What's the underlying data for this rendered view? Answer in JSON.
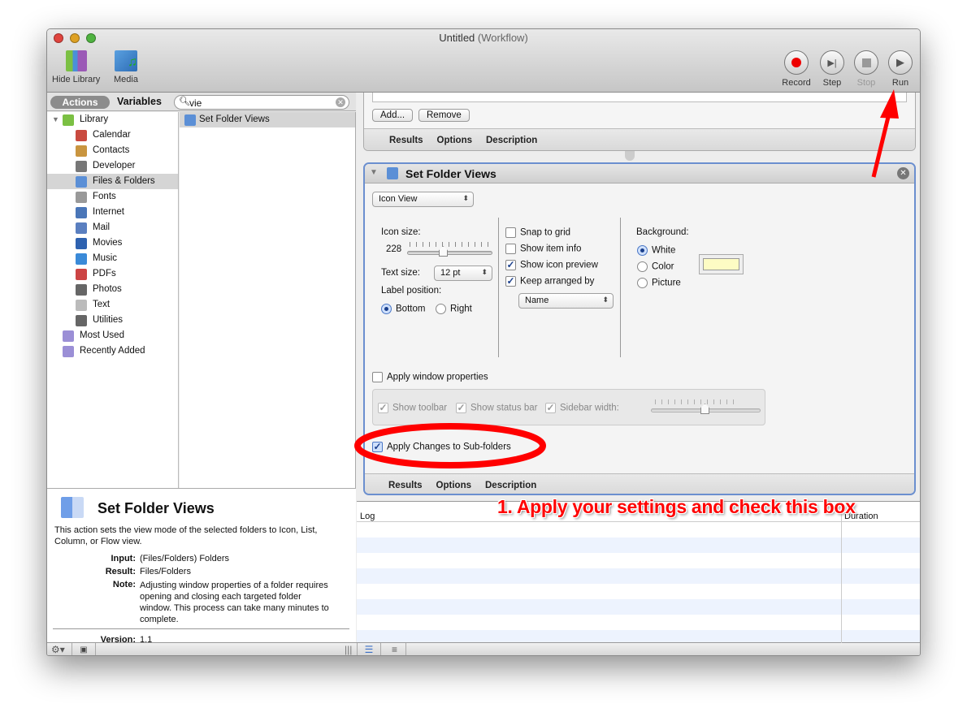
{
  "window": {
    "title": "Untitled",
    "subtitle": "(Workflow)"
  },
  "toolbar": {
    "hide_library": "Hide Library",
    "media": "Media",
    "record": "Record",
    "step": "Step",
    "stop": "Stop",
    "run": "Run"
  },
  "library": {
    "tab_actions": "Actions",
    "tab_variables": "Variables",
    "search_value": "vie",
    "items": [
      "Library",
      "Calendar",
      "Contacts",
      "Developer",
      "Files & Folders",
      "Fonts",
      "Internet",
      "Mail",
      "Movies",
      "Music",
      "PDFs",
      "Photos",
      "Text",
      "Utilities",
      "Most Used",
      "Recently Added"
    ],
    "selected": "Files & Folders",
    "results": [
      "Set Folder Views"
    ]
  },
  "description": {
    "title": "Set Folder Views",
    "body": "This action sets the view mode of the selected folders to Icon, List, Column, or Flow view.",
    "input_label": "Input:",
    "input": "(Files/Folders) Folders",
    "result_label": "Result:",
    "result": "Files/Folders",
    "note_label": "Note:",
    "note": "Adjusting window properties of a folder requires opening and closing each targeted folder window. This process can take many minutes to complete.",
    "version_label": "Version:",
    "version": "1.1"
  },
  "prev_action": {
    "add": "Add...",
    "remove": "Remove",
    "tabs": [
      "Results",
      "Options",
      "Description"
    ]
  },
  "action": {
    "title": "Set Folder Views",
    "view_mode": "Icon View",
    "icon_size_label": "Icon size:",
    "icon_size": "228",
    "icon_size_fraction": 0.37,
    "text_size_label": "Text size:",
    "text_size": "12 pt",
    "label_position_label": "Label position:",
    "label_bottom": "Bottom",
    "label_right": "Right",
    "label_position": "Bottom",
    "snap_to_grid": "Snap to grid",
    "show_item_info": "Show item info",
    "show_icon_preview": "Show icon preview",
    "keep_arranged_by": "Keep arranged by",
    "arranged_by": "Name",
    "checks": {
      "snap_to_grid": false,
      "show_item_info": false,
      "show_icon_preview": true,
      "keep_arranged_by": true,
      "apply_window_properties": false,
      "apply_subfolders": true
    },
    "background_label": "Background:",
    "bg_white": "White",
    "bg_color": "Color",
    "bg_picture": "Picture",
    "background": "White",
    "color_swatch": "#fdfcc4",
    "apply_window_properties": "Apply window properties",
    "show_toolbar": "Show toolbar",
    "show_status_bar": "Show status bar",
    "sidebar_width": "Sidebar width:",
    "sidebar_fraction": 0.5,
    "apply_subfolders": "Apply Changes to Sub-folders",
    "tabs": [
      "Results",
      "Options",
      "Description"
    ]
  },
  "log": {
    "col_log": "Log",
    "col_duration": "Duration"
  },
  "annotation": {
    "text": "1. Apply your settings and check this box",
    "color": "#ff0000"
  }
}
